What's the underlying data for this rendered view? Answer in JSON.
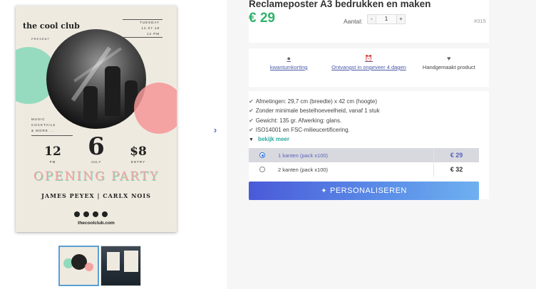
{
  "product": {
    "title": "Reclameposter A3 bedrukken en maken",
    "price": "€ 29",
    "qty_label": "Aantal:",
    "qty_minus": "-",
    "qty_value": "1",
    "qty_plus": "+",
    "sku": "#315"
  },
  "poster": {
    "club": "the cool club",
    "present": "PRESENT",
    "day": "TUESDAY",
    "date": "12.07.18",
    "time": "12 PM",
    "menu": [
      "MUSIC",
      "COCKTAILS",
      "& MORE ..."
    ],
    "big_left": "12",
    "big_left_lbl": "PM",
    "big_mid": "6",
    "big_mid_lbl": "JULY",
    "big_right": "$8",
    "big_right_lbl": "ENTRY",
    "headline": "OPENING PARTY",
    "artists": "JAMES PEYEX  |  CARLX NOIS",
    "site": "thecoolclub.com"
  },
  "gallery": {
    "next_arrow": "›"
  },
  "usps": [
    {
      "icon": "piggy-bank-icon",
      "label": "kwantumkorting",
      "link": true
    },
    {
      "icon": "alarm-clock-icon",
      "label": "Ontvangst in ongeveer 4 dagen",
      "link": true
    },
    {
      "icon": "heart-icon",
      "label": "Handgemaakt product",
      "link": false
    }
  ],
  "specs": [
    "Afmetingen: 29,7 cm (breedte) x 42 cm (hoogte)",
    "Zonder minimale bestelhoeveelheid, vanaf 1 stuk",
    "Gewicht: 135 gr. Afwerking: glans.",
    "ISO14001 en FSC-milieucertificering."
  ],
  "more_link": "bekijk meer",
  "options": [
    {
      "label": "1 kanten (pack x100)",
      "price": "€ 29",
      "selected": true
    },
    {
      "label": "2 kanten (pack x100)",
      "price": "€ 32",
      "selected": false
    }
  ],
  "cta_label": "PERSONALISEREN"
}
